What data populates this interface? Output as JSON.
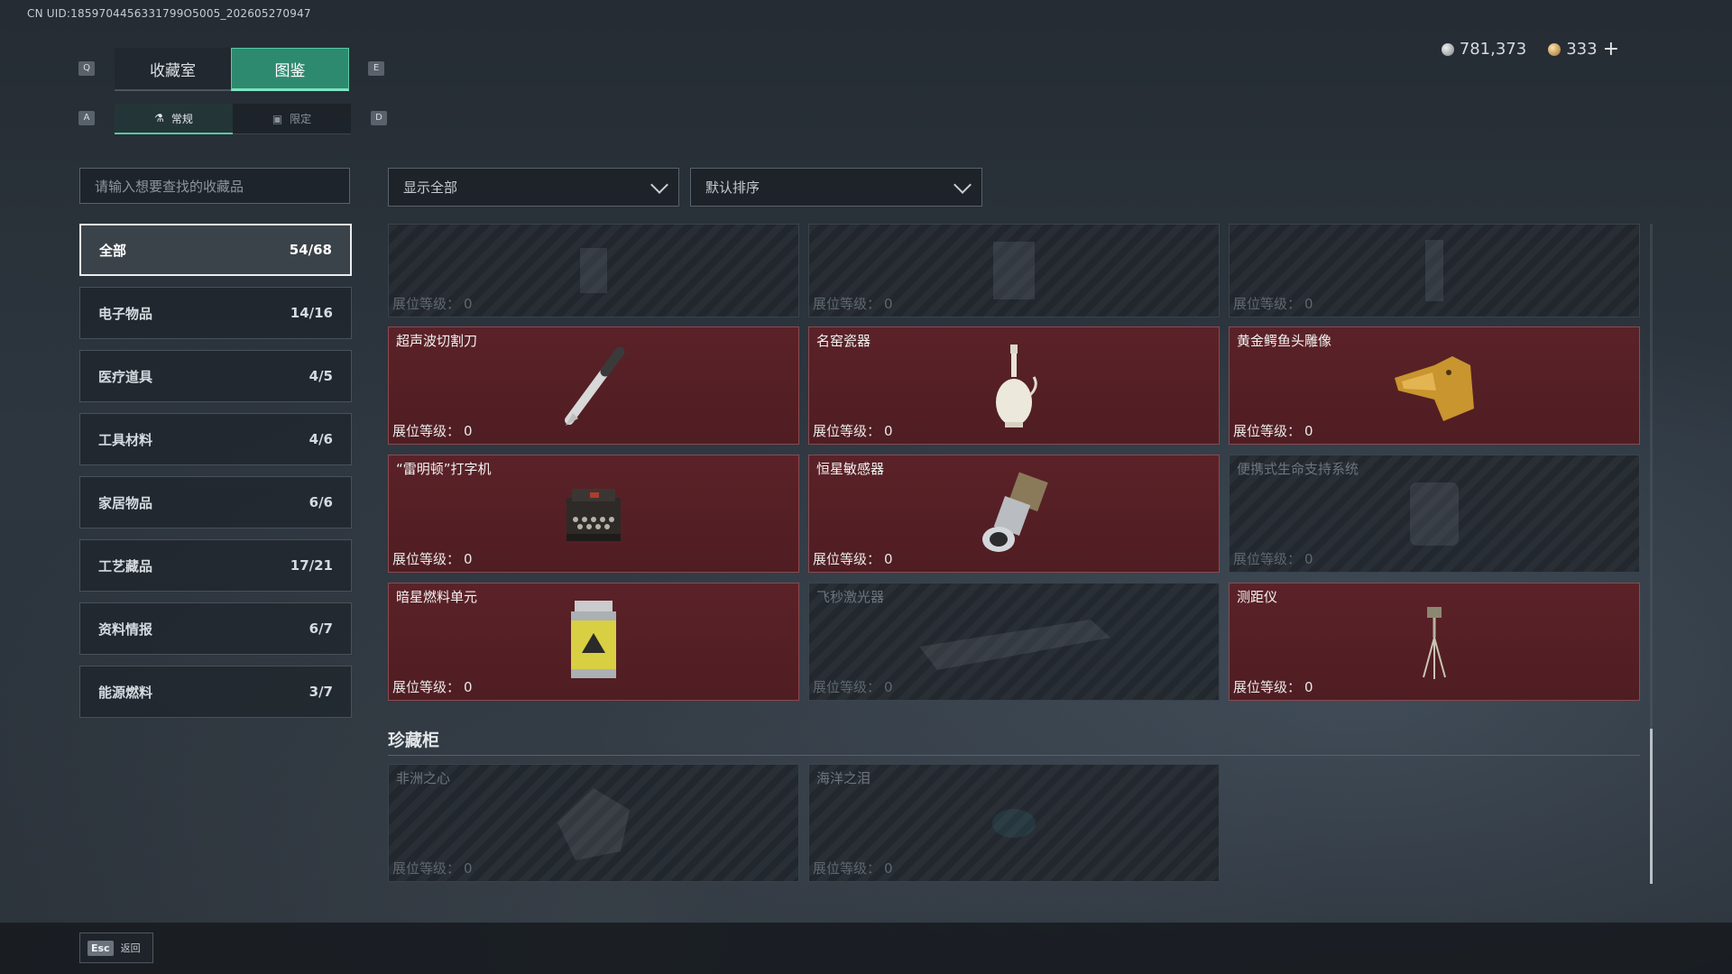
{
  "uid": "CN UID:1859704456331799O5005_202605270947",
  "currency": {
    "silver": "781,373",
    "gold": "333",
    "add": "+"
  },
  "keys": {
    "left_main": "Q",
    "right_main": "E",
    "left_sub": "A",
    "right_sub": "D"
  },
  "tabs_main": [
    "收藏室",
    "图鉴"
  ],
  "tabs_sub": [
    "常规",
    "限定"
  ],
  "search_placeholder": "请输入想要查找的收藏品",
  "categories": [
    {
      "label": "全部",
      "count": "54/68"
    },
    {
      "label": "电子物品",
      "count": "14/16"
    },
    {
      "label": "医疗道具",
      "count": "4/5"
    },
    {
      "label": "工具材料",
      "count": "4/6"
    },
    {
      "label": "家居物品",
      "count": "6/6"
    },
    {
      "label": "工艺藏品",
      "count": "17/21"
    },
    {
      "label": "资料情报",
      "count": "6/7"
    },
    {
      "label": "能源燃料",
      "count": "3/7"
    }
  ],
  "filter_label": "显示全部",
  "sort_label": "默认排序",
  "level_label": "展位等级：",
  "items": [
    {
      "name": "",
      "level": "0",
      "owned": false,
      "icon": "generic-collectible-icon"
    },
    {
      "name": "",
      "level": "0",
      "owned": false,
      "icon": "generic-collectible-icon"
    },
    {
      "name": "",
      "level": "0",
      "owned": false,
      "icon": "generic-collectible-icon"
    },
    {
      "name": "超声波切割刀",
      "level": "0",
      "owned": true,
      "icon": "ultrasonic-knife-icon"
    },
    {
      "name": "名窑瓷器",
      "level": "0",
      "owned": true,
      "icon": "porcelain-vase-icon"
    },
    {
      "name": "黄金鳄鱼头雕像",
      "level": "0",
      "owned": true,
      "icon": "golden-crocodile-icon"
    },
    {
      "name": "“雷明顿”打字机",
      "level": "0",
      "owned": true,
      "icon": "typewriter-icon"
    },
    {
      "name": "恒星敏感器",
      "level": "0",
      "owned": true,
      "icon": "star-sensor-icon"
    },
    {
      "name": "便携式生命支持系统",
      "level": "0",
      "owned": false,
      "icon": "life-support-icon"
    },
    {
      "name": "暗星燃料单元",
      "level": "0",
      "owned": true,
      "icon": "fuel-cell-icon"
    },
    {
      "name": "飞秒激光器",
      "level": "0",
      "owned": false,
      "icon": "laser-icon"
    },
    {
      "name": "测距仪",
      "level": "0",
      "owned": true,
      "icon": "rangefinder-icon"
    }
  ],
  "showcase_title": "珍藏柜",
  "showcase_items": [
    {
      "name": "非洲之心",
      "level": "0",
      "owned": false,
      "icon": "gem-icon"
    },
    {
      "name": "海洋之泪",
      "level": "0",
      "owned": false,
      "icon": "gem-icon"
    }
  ],
  "footer": {
    "esc_key": "Esc",
    "esc_label": "返回"
  }
}
